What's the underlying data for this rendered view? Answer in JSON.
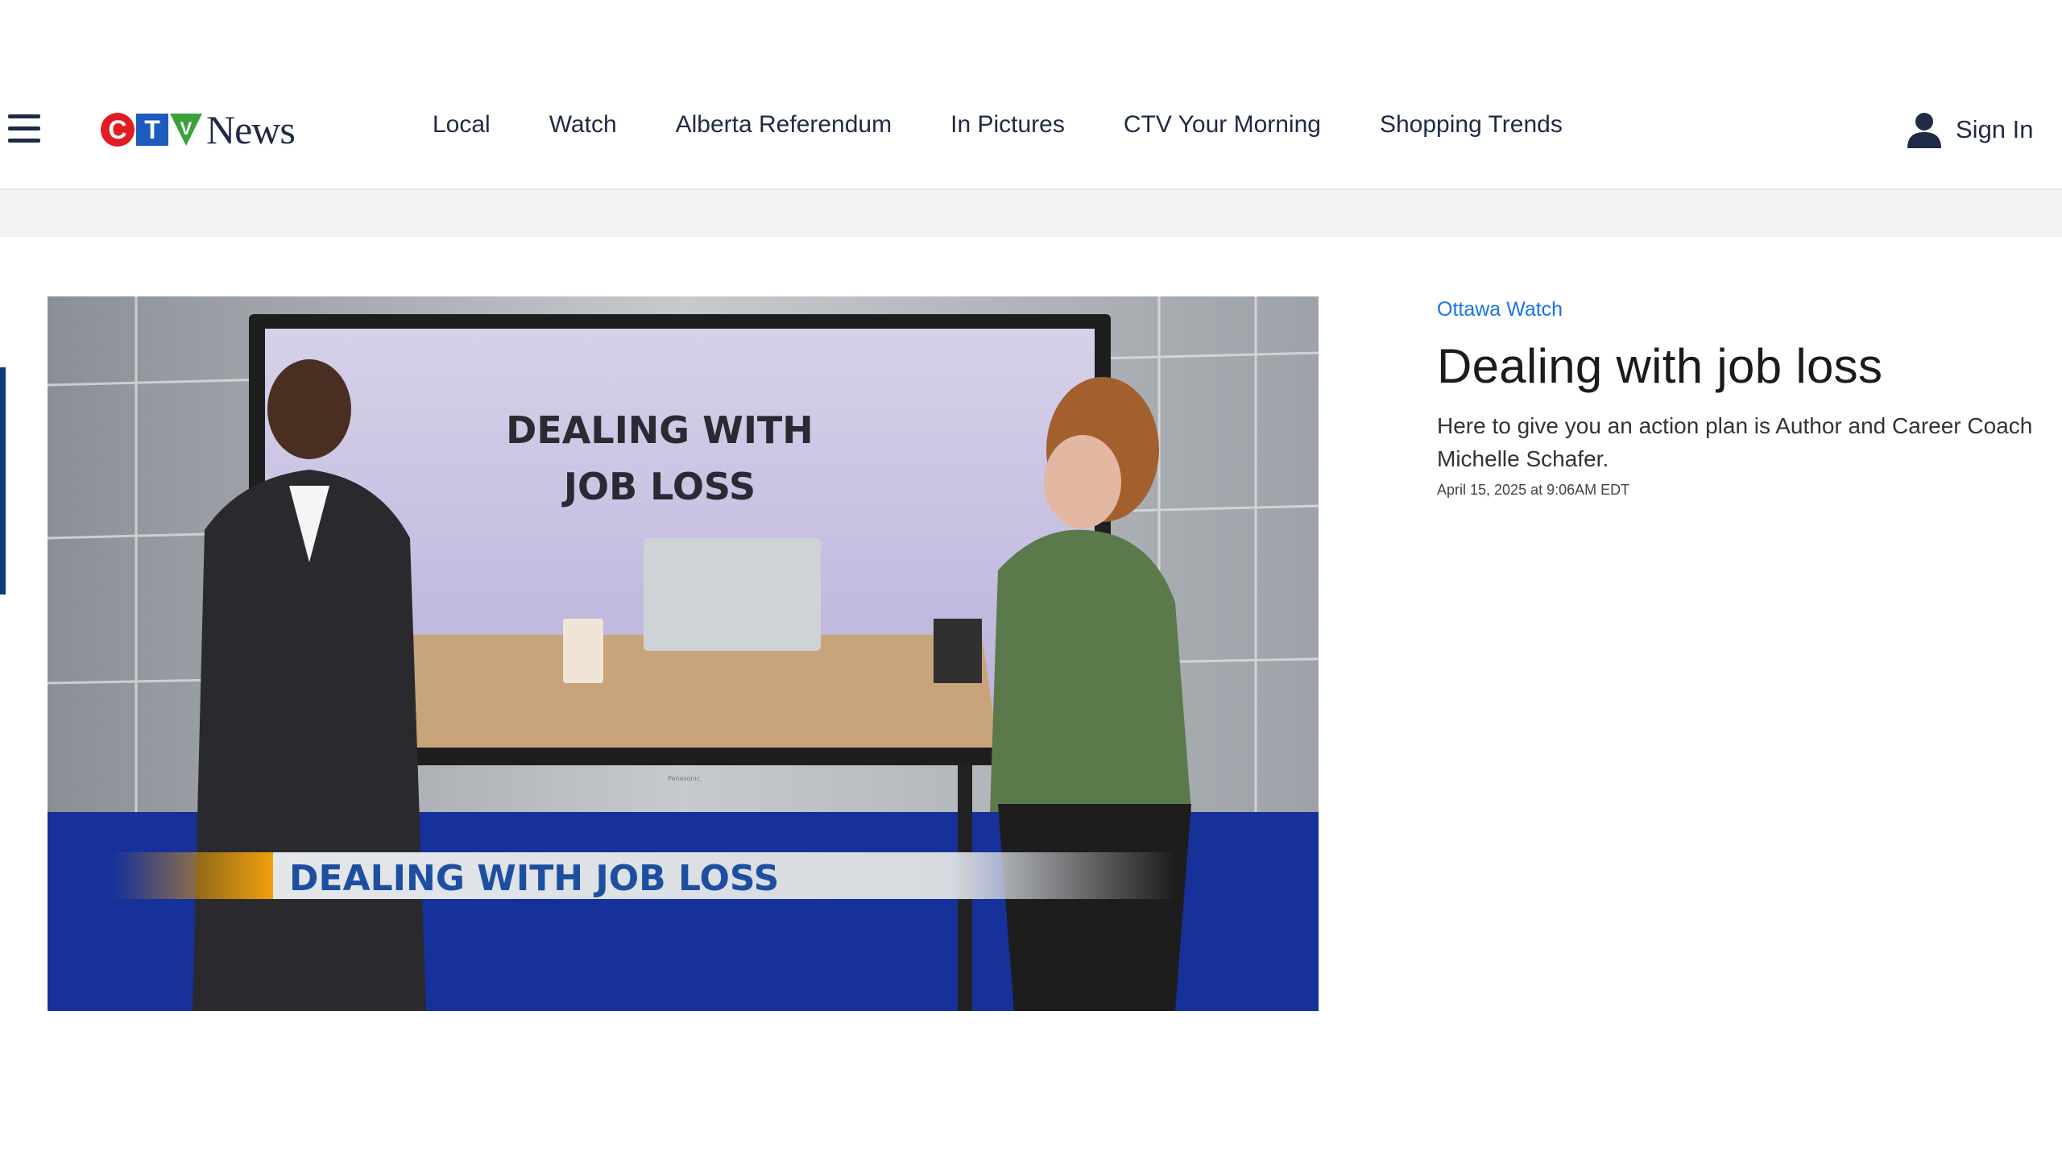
{
  "header": {
    "logo": {
      "ctv_letters": [
        "C",
        "T",
        "V"
      ],
      "news_word": "News"
    },
    "nav_items": [
      {
        "label": "Local"
      },
      {
        "label": "Watch"
      },
      {
        "label": "Alberta Referendum"
      },
      {
        "label": "In Pictures"
      },
      {
        "label": "CTV Your Morning"
      },
      {
        "label": "Shopping Trends"
      }
    ],
    "sign_in_label": "Sign In",
    "icons": {
      "menu": "hamburger-menu-icon",
      "user": "user-icon"
    },
    "colors": {
      "nav_text": "#1f2a44",
      "ctv_red": "#e31b23",
      "ctv_blue": "#1e5bbf",
      "ctv_green": "#3aa23a"
    }
  },
  "video": {
    "screen_text_line1": "DEALING WITH",
    "screen_text_line2": "JOB LOSS",
    "lower_third": "DEALING WITH JOB LOSS",
    "tv_brand": "Panasonic"
  },
  "article": {
    "section": "Ottawa Watch",
    "title": "Dealing with job loss",
    "description": "Here to give you an action plan is Author and Career Coach Michelle Schafer.",
    "date": "April 15, 2025 at 9:06AM EDT",
    "colors": {
      "section_link": "#1a73e8"
    }
  }
}
